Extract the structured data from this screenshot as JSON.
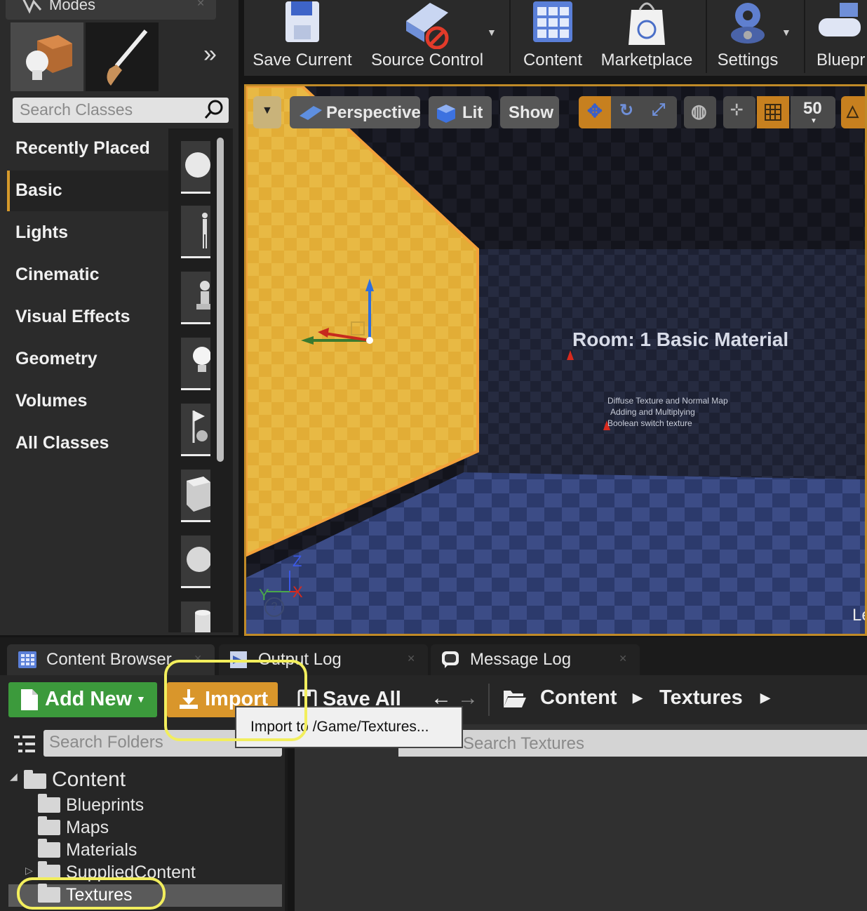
{
  "modes_panel": {
    "title": "Modes",
    "search_placeholder": "Search Classes",
    "categories": [
      {
        "label": "Recently Placed",
        "selected": false
      },
      {
        "label": "Basic",
        "selected": true
      },
      {
        "label": "Lights",
        "selected": false
      },
      {
        "label": "Cinematic",
        "selected": false
      },
      {
        "label": "Visual Effects",
        "selected": false
      },
      {
        "label": "Geometry",
        "selected": false
      },
      {
        "label": "Volumes",
        "selected": false
      },
      {
        "label": "All Classes",
        "selected": false
      }
    ]
  },
  "toolbar": {
    "save_current": "Save Current",
    "source_control": "Source Control",
    "content": "Content",
    "marketplace": "Marketplace",
    "settings": "Settings",
    "blueprints": "Bluepr"
  },
  "viewport": {
    "perspective": "Perspective",
    "lit": "Lit",
    "show": "Show",
    "grid_snap": "50",
    "room_title": "Room: 1 Basic Material",
    "room_lines": [
      "Diffuse Texture and Normal Map",
      "Adding and Multiplying",
      "Boolean switch texture"
    ],
    "axis_z": "Z",
    "axis_y": "Y",
    "axis_x": "X",
    "level_label": "Le"
  },
  "bottom_tabs": {
    "content_browser": "Content Browser",
    "output_log": "Output Log",
    "message_log": "Message Log"
  },
  "content_browser": {
    "add_new": "Add New",
    "import": "Import",
    "save_all": "Save All",
    "breadcrumb": [
      "Content",
      "Textures"
    ],
    "import_tooltip": "Import to /Game/Textures...",
    "search_folders_placeholder": "Search Folders",
    "search_assets_placeholder": "Search Textures",
    "tree": {
      "root": "Content",
      "children": [
        "Blueprints",
        "Maps",
        "Materials",
        "SuppliedContent",
        "Textures"
      ]
    }
  },
  "colors": {
    "accent": "#d69a2b",
    "add_new_green": "#3c9a3c",
    "highlight": "#f2ee5d"
  }
}
